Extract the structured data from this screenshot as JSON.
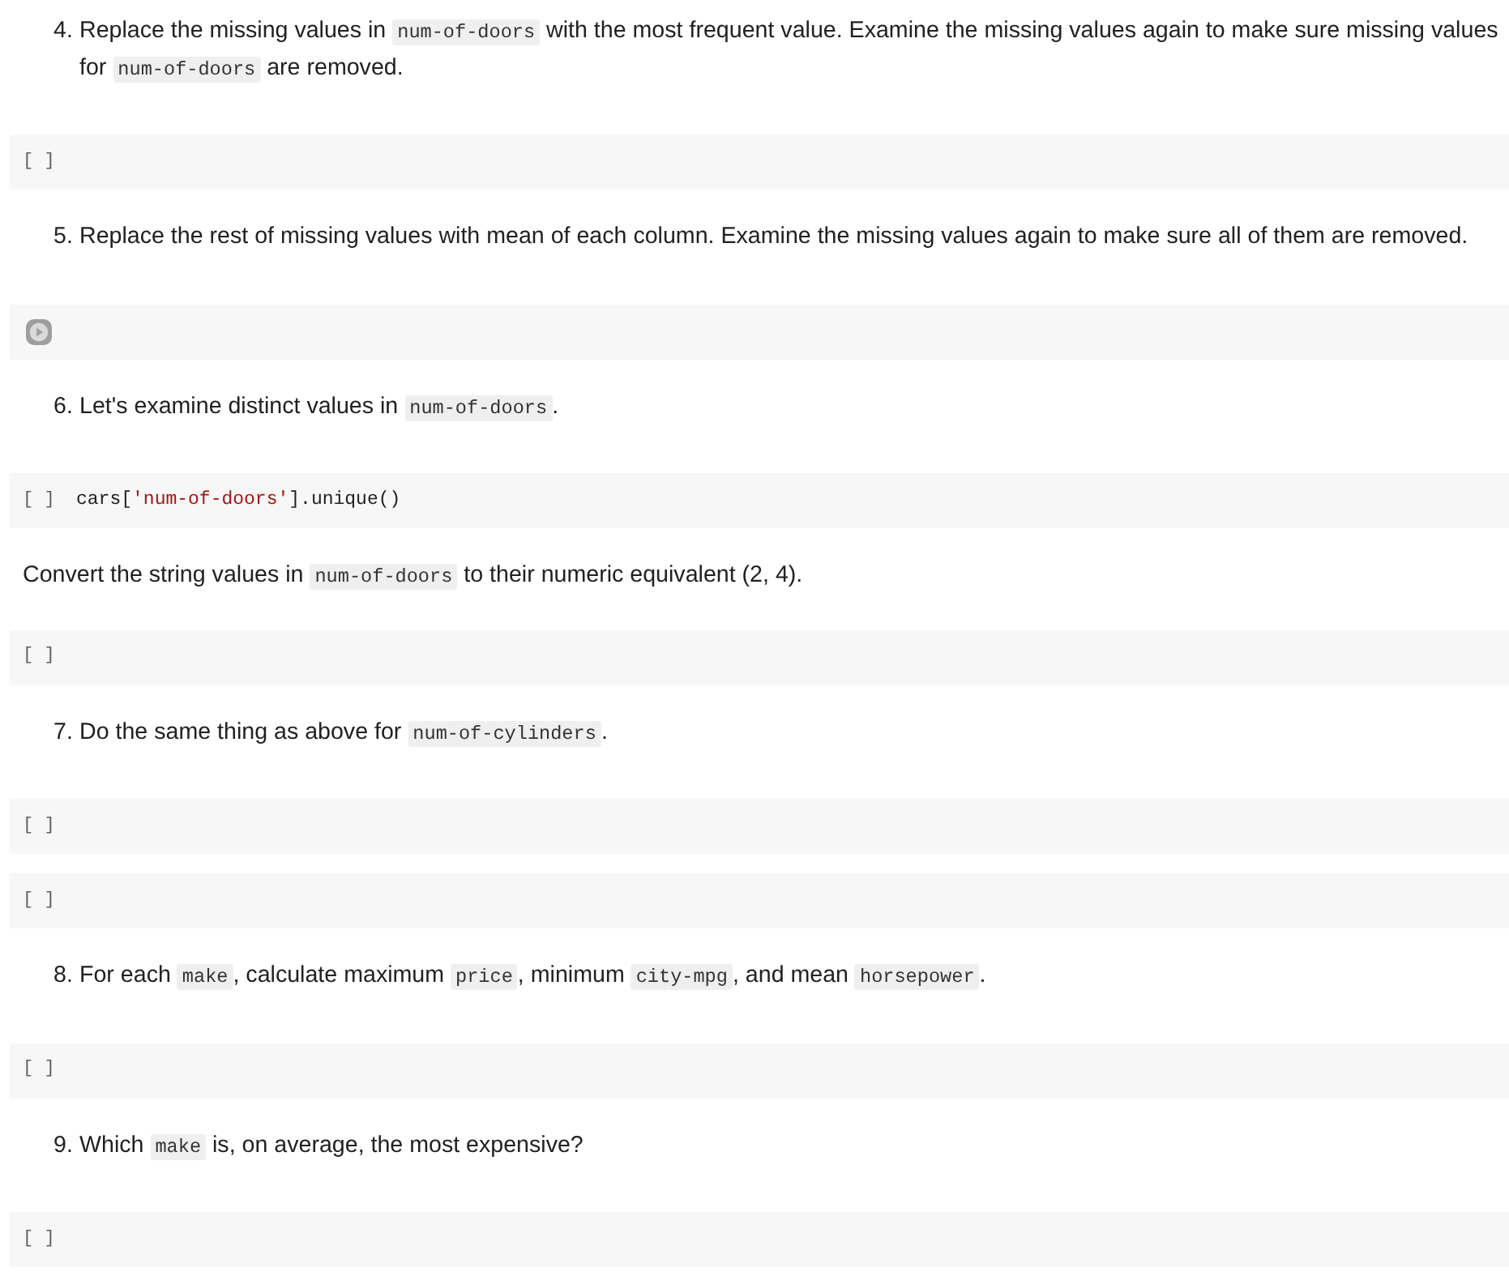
{
  "cells": [
    {
      "kind": "text",
      "number": "4.",
      "parts": [
        {
          "text": "Replace the missing values in ",
          "kind": "plain"
        },
        {
          "text": "num-of-doors",
          "kind": "code"
        },
        {
          "text": " with the most frequent value. Examine the missing values again to make sure missing values for ",
          "kind": "plain"
        },
        {
          "text": "num-of-doors",
          "kind": "code"
        },
        {
          "text": " are removed.",
          "kind": "plain"
        }
      ]
    },
    {
      "kind": "code",
      "hovered": false,
      "prompt": "[ ]"
    },
    {
      "kind": "text",
      "number": "5.",
      "parts": [
        {
          "text": "Replace the rest of missing values with mean of each column. Examine the missing values again to make sure all of them are removed.",
          "kind": "plain"
        }
      ]
    },
    {
      "kind": "code",
      "hovered": true
    },
    {
      "kind": "text",
      "number": "6.",
      "parts": [
        {
          "text": "Let's examine distinct values in ",
          "kind": "plain"
        },
        {
          "text": "num-of-doors",
          "kind": "code"
        },
        {
          "text": ".",
          "kind": "plain"
        }
      ]
    },
    {
      "kind": "code",
      "hovered": false,
      "prompt": "[ ]",
      "code": [
        {
          "text": "cars[",
          "kind": "plain"
        },
        {
          "text": "'num-of-doors'",
          "kind": "string"
        },
        {
          "text": "].unique()",
          "kind": "plain"
        }
      ]
    },
    {
      "kind": "text",
      "parts": [
        {
          "text": "Convert the string values in ",
          "kind": "plain"
        },
        {
          "text": "num-of-doors",
          "kind": "code"
        },
        {
          "text": " to their numeric equivalent (2, 4).",
          "kind": "plain"
        }
      ]
    },
    {
      "kind": "code",
      "hovered": false,
      "prompt": "[ ]"
    },
    {
      "kind": "text",
      "number": "7.",
      "parts": [
        {
          "text": "Do the same thing as above for ",
          "kind": "plain"
        },
        {
          "text": "num-of-cylinders",
          "kind": "code"
        },
        {
          "text": ".",
          "kind": "plain"
        }
      ]
    },
    {
      "kind": "code",
      "hovered": false,
      "prompt": "[ ]"
    },
    {
      "kind": "code",
      "hovered": false,
      "prompt": "[ ]"
    },
    {
      "kind": "text",
      "number": "8.",
      "parts": [
        {
          "text": "For each ",
          "kind": "plain"
        },
        {
          "text": "make",
          "kind": "code"
        },
        {
          "text": ", calculate maximum ",
          "kind": "plain"
        },
        {
          "text": "price",
          "kind": "code"
        },
        {
          "text": ", minimum ",
          "kind": "plain"
        },
        {
          "text": "city-mpg",
          "kind": "code"
        },
        {
          "text": ", and mean ",
          "kind": "plain"
        },
        {
          "text": "horsepower",
          "kind": "code"
        },
        {
          "text": ".",
          "kind": "plain"
        }
      ]
    },
    {
      "kind": "code",
      "hovered": false,
      "prompt": "[ ]"
    },
    {
      "kind": "text",
      "number": "9.",
      "parts": [
        {
          "text": "Which ",
          "kind": "plain"
        },
        {
          "text": "make",
          "kind": "code"
        },
        {
          "text": " is, on average, the most expensive?",
          "kind": "plain"
        }
      ]
    },
    {
      "kind": "code",
      "hovered": false,
      "prompt": "[ ]"
    }
  ]
}
